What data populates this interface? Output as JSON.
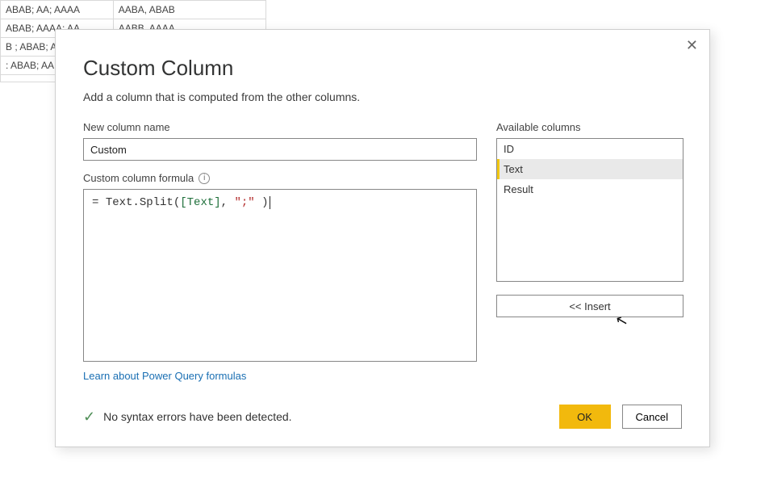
{
  "bg_rows": [
    {
      "a": "ABAB; AA; AAAA",
      "b": "AABA, ABAB"
    },
    {
      "a": "ABAB; AAAA: AA",
      "b": "AABB. AAAA"
    },
    {
      "a": "B ; ABAB; A",
      "b": ""
    },
    {
      "a": ": ABAB; AA; .",
      "b": ""
    },
    {
      "a": "",
      "b": ""
    }
  ],
  "dialog": {
    "title": "Custom Column",
    "subtitle": "Add a column that is computed from the other columns.",
    "name_label": "New column name",
    "name_value": "Custom",
    "formula_label": "Custom column formula",
    "formula_parts": {
      "prefix": "= ",
      "func": "Text.Split",
      "open": "(",
      "ref": "[Text]",
      "sep": ", ",
      "str": "\";\"",
      "tail": " )",
      "close": ""
    },
    "learn_link": "Learn about Power Query formulas",
    "avail_label": "Available columns",
    "avail_columns": [
      "ID",
      "Text",
      "Result"
    ],
    "avail_selected_index": 1,
    "insert_label": "<< Insert",
    "status": "No syntax errors have been detected.",
    "ok_label": "OK",
    "cancel_label": "Cancel"
  }
}
